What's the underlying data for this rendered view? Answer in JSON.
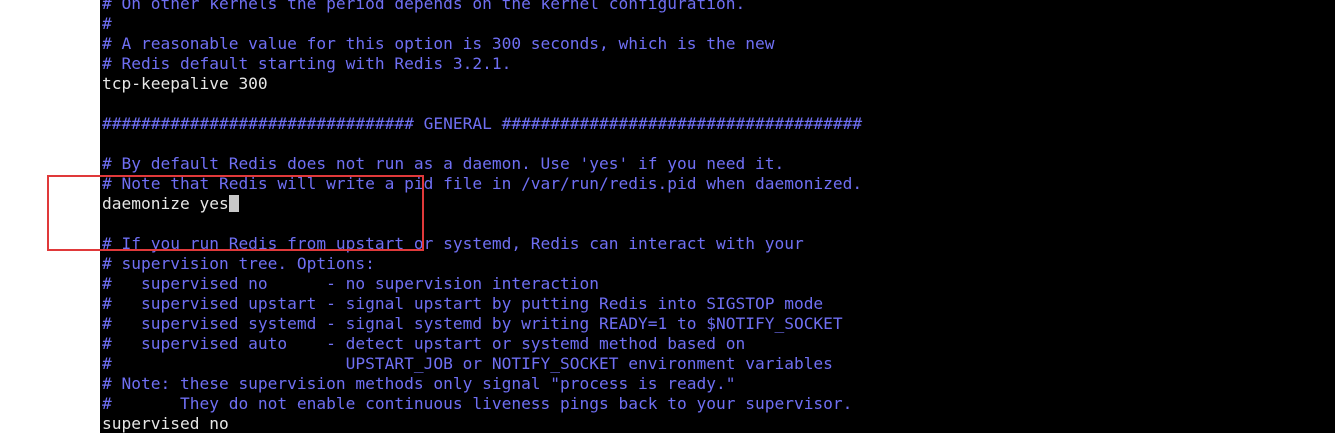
{
  "editor": {
    "lines": [
      {
        "kind": "comment",
        "text": "# On other kernels the period depends on the kernel configuration."
      },
      {
        "kind": "comment",
        "text": "#"
      },
      {
        "kind": "comment",
        "text": "# A reasonable value for this option is 300 seconds, which is the new"
      },
      {
        "kind": "comment",
        "text": "# Redis default starting with Redis 3.2.1."
      },
      {
        "kind": "code",
        "text": "tcp-keepalive 300"
      },
      {
        "kind": "blank",
        "text": ""
      },
      {
        "kind": "comment",
        "text": "################################ GENERAL #####################################"
      },
      {
        "kind": "blank",
        "text": ""
      },
      {
        "kind": "comment",
        "text": "# By default Redis does not run as a daemon. Use 'yes' if you need it."
      },
      {
        "kind": "comment",
        "text": "# Note that Redis will write a pid file in /var/run/redis.pid when daemonized."
      },
      {
        "kind": "code",
        "text": "daemonize yes",
        "cursor": true
      },
      {
        "kind": "blank",
        "text": ""
      },
      {
        "kind": "comment",
        "text": "# If you run Redis from upstart or systemd, Redis can interact with your"
      },
      {
        "kind": "comment",
        "text": "# supervision tree. Options:"
      },
      {
        "kind": "comment",
        "text": "#   supervised no      - no supervision interaction"
      },
      {
        "kind": "comment",
        "text": "#   supervised upstart - signal upstart by putting Redis into SIGSTOP mode"
      },
      {
        "kind": "comment",
        "text": "#   supervised systemd - signal systemd by writing READY=1 to $NOTIFY_SOCKET"
      },
      {
        "kind": "comment",
        "text": "#   supervised auto    - detect upstart or systemd method based on"
      },
      {
        "kind": "comment",
        "text": "#                        UPSTART_JOB or NOTIFY_SOCKET environment variables"
      },
      {
        "kind": "comment",
        "text": "# Note: these supervision methods only signal \"process is ready.\""
      },
      {
        "kind": "comment",
        "text": "#       They do not enable continuous liveness pings back to your supervisor."
      },
      {
        "kind": "code",
        "text": "supervised no"
      }
    ]
  },
  "colors": {
    "terminal_background": "#000000",
    "comment_text": "#6f6ff3",
    "code_text": "#e6e6e6",
    "annotation_box": "#e0393a"
  }
}
